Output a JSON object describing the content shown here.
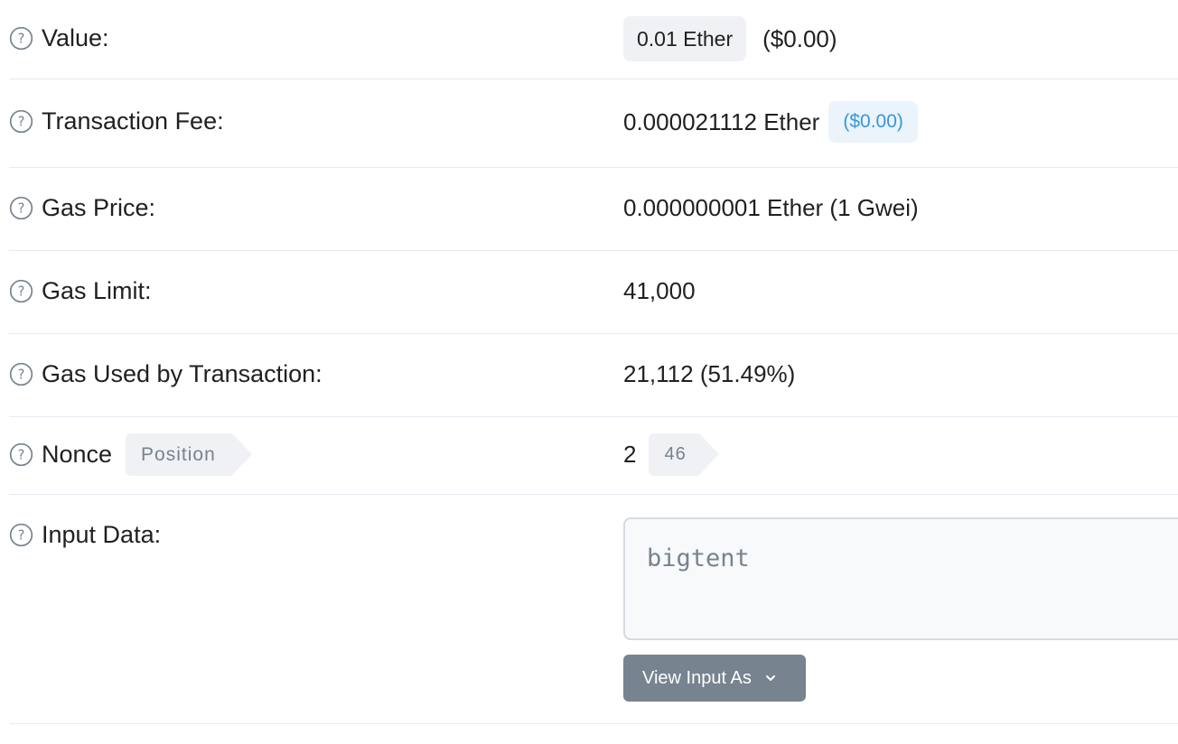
{
  "rows": {
    "value": {
      "label": "Value:",
      "amount": "0.01 Ether",
      "usd": "($0.00)"
    },
    "fee": {
      "label": "Transaction Fee:",
      "amount": "0.000021112 Ether",
      "usd": "($0.00)"
    },
    "gas_price": {
      "label": "Gas Price:",
      "value": "0.000000001 Ether (1 Gwei)"
    },
    "gas_limit": {
      "label": "Gas Limit:",
      "value": "41,000"
    },
    "gas_used": {
      "label": "Gas Used by Transaction:",
      "value": "21,112 (51.49%)"
    },
    "nonce": {
      "label": "Nonce",
      "position_tag": "Position",
      "value": "2",
      "position_value": "46"
    },
    "input_data": {
      "label": "Input Data:",
      "content": "bigtent",
      "view_button": "View Input As"
    }
  },
  "icons": {
    "help": "question-circle-icon",
    "dropdown": "chevron-down-icon"
  },
  "colors": {
    "blue_text": "#3498db",
    "muted": "#77838f",
    "pill_bg": "#f0f1f4"
  }
}
